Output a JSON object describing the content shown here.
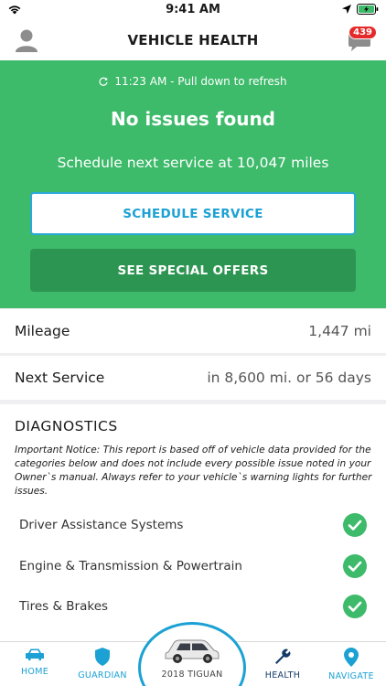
{
  "status_bar": {
    "time": "9:41 AM"
  },
  "header": {
    "title": "VEHICLE HEALTH",
    "message_count": "439"
  },
  "hero": {
    "refresh_text": "11:23 AM - Pull down to refresh",
    "title": "No issues found",
    "subtitle": "Schedule next service at 10,047 miles",
    "schedule_button": "SCHEDULE SERVICE",
    "offers_button": "SEE SPECIAL OFFERS"
  },
  "info": [
    {
      "label": "Mileage",
      "value": "1,447 mi"
    },
    {
      "label": "Next Service",
      "value": "in 8,600 mi. or 56 days"
    }
  ],
  "diagnostics": {
    "title": "DIAGNOSTICS",
    "notice": "Important Notice: This report is based off of vehicle data provided for the categories below and does not include every possible issue noted in your Owner`s manual.  Always refer to your vehicle`s warning lights for further issues.",
    "items": [
      {
        "label": "Driver Assistance Systems",
        "status": "check-icon"
      },
      {
        "label": "Engine & Transmission & Powertrain",
        "status": "check-icon"
      },
      {
        "label": "Tires & Brakes",
        "status": "check-icon"
      }
    ]
  },
  "tabbar": {
    "home": "HOME",
    "guardian": "GUARDIAN",
    "vehicle": "2018 TIGUAN",
    "health": "HEALTH",
    "navigate": "NAVIGATE"
  },
  "colors": {
    "hero_green": "#3dba6a",
    "offers_green": "#2d9552",
    "accent_blue": "#1ba1d3",
    "active_navy": "#163b69",
    "badge_red": "#e52a2a"
  }
}
